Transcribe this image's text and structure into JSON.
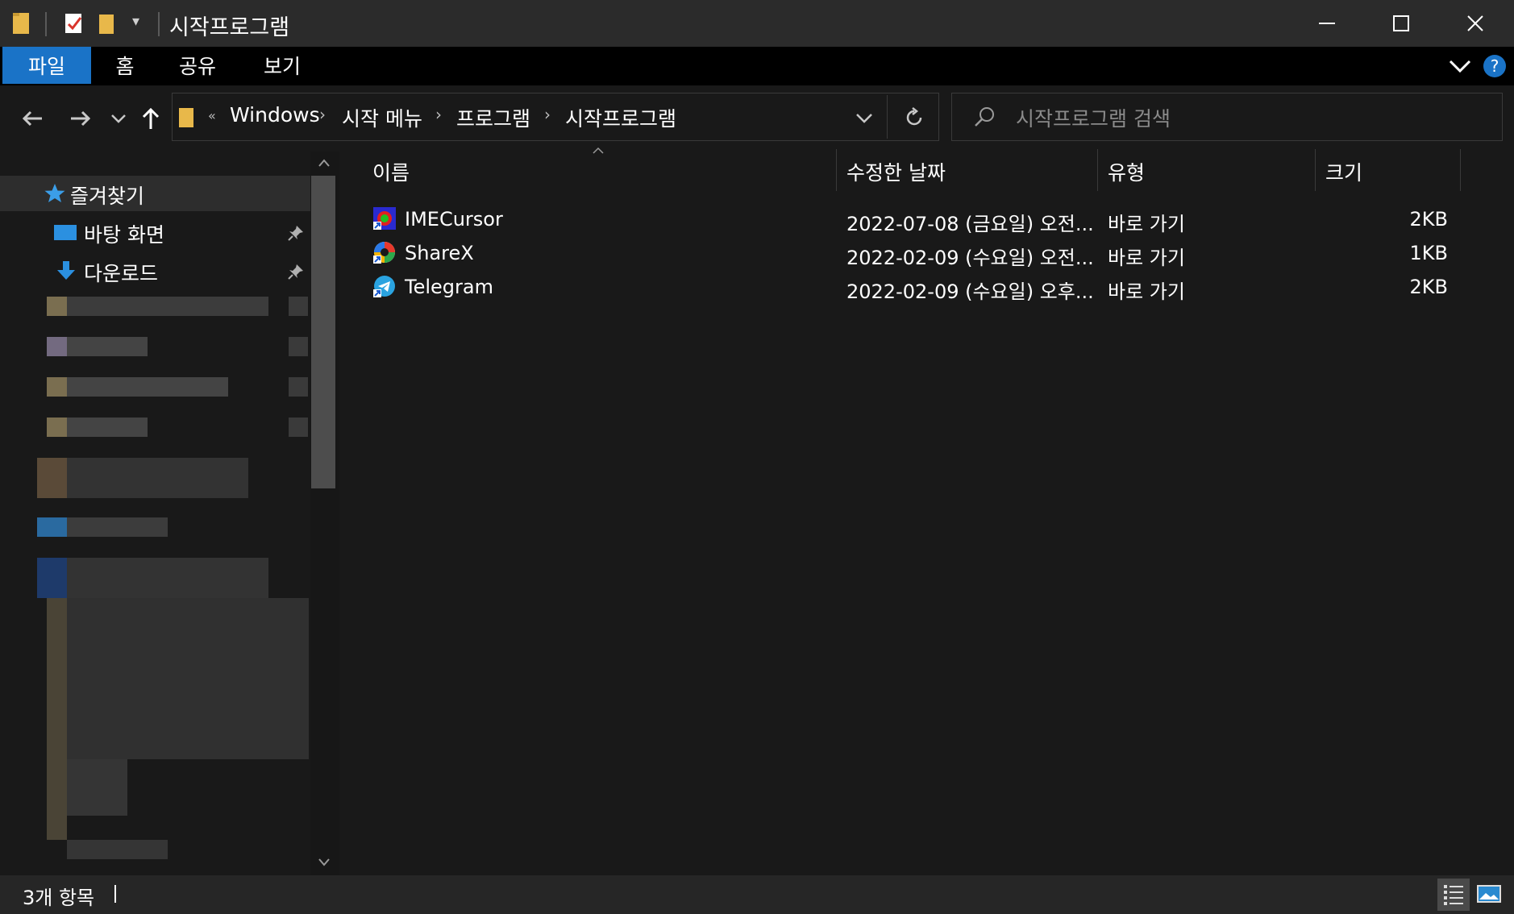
{
  "window": {
    "title": "시작프로그램"
  },
  "ribbon": {
    "tabs": [
      "파일",
      "홈",
      "공유",
      "보기"
    ],
    "help": "?"
  },
  "address": {
    "overflow": "«",
    "crumbs": [
      "Windows",
      "시작 메뉴",
      "프로그램",
      "시작프로그램"
    ],
    "search_placeholder": "시작프로그램 검색"
  },
  "nav": {
    "favorites": "즐겨찾기",
    "items": [
      "바탕 화면",
      "다운로드"
    ]
  },
  "columns": {
    "name": "이름",
    "modified": "수정한 날짜",
    "type": "유형",
    "size": "크기"
  },
  "files": [
    {
      "name": "IMECursor",
      "modified": "2022-07-08 (금요일) 오전...",
      "type": "바로 가기",
      "size": "2KB"
    },
    {
      "name": "ShareX",
      "modified": "2022-02-09 (수요일) 오전...",
      "type": "바로 가기",
      "size": "1KB"
    },
    {
      "name": "Telegram",
      "modified": "2022-02-09 (수요일) 오후...",
      "type": "바로 가기",
      "size": "2KB"
    }
  ],
  "status": {
    "count": "3개 항목"
  },
  "colors": {
    "accent": "#1a73c7",
    "background": "#191919",
    "titlebar": "#2b2b2b"
  }
}
